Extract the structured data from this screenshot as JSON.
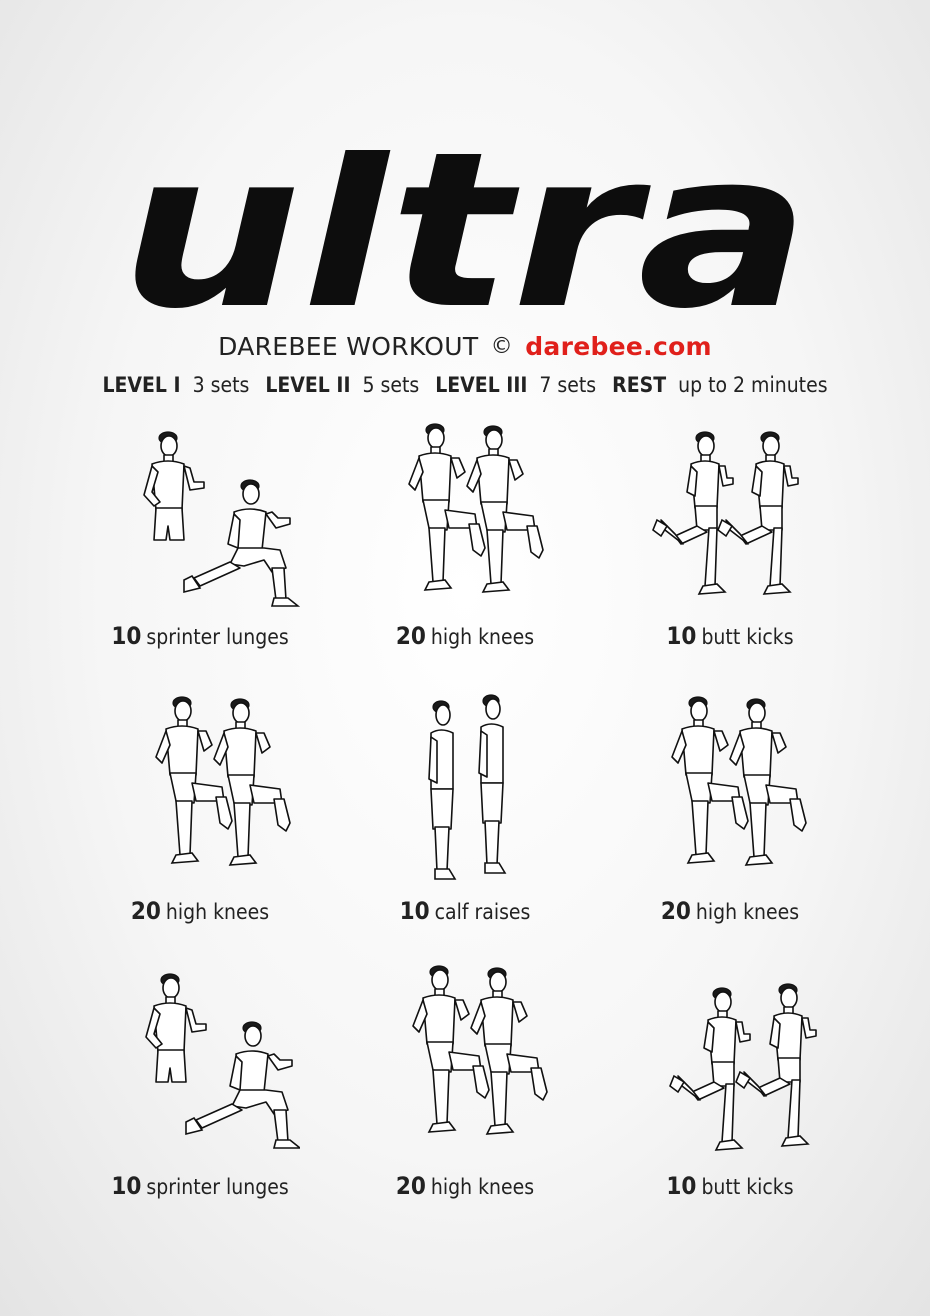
{
  "title": "ultra",
  "subtitle": {
    "prefix": "DAREBEE WORKOUT",
    "copyright": "©",
    "brand": "darebee.com"
  },
  "levels": [
    {
      "label": "LEVEL I",
      "value": "3 sets"
    },
    {
      "label": "LEVEL II",
      "value": "5 sets"
    },
    {
      "label": "LEVEL III",
      "value": "7 sets"
    },
    {
      "label": "REST",
      "value": "up to 2 minutes"
    }
  ],
  "exercises": [
    {
      "reps": "10",
      "name": "sprinter lunges",
      "icon": "sprinter-lunge-figure"
    },
    {
      "reps": "20",
      "name": "high knees",
      "icon": "high-knees-figure"
    },
    {
      "reps": "10",
      "name": "butt kicks",
      "icon": "butt-kicks-figure"
    },
    {
      "reps": "20",
      "name": "high knees",
      "icon": "high-knees-figure"
    },
    {
      "reps": "10",
      "name": "calf raises",
      "icon": "calf-raise-figure"
    },
    {
      "reps": "20",
      "name": "high knees",
      "icon": "high-knees-figure"
    },
    {
      "reps": "10",
      "name": "sprinter lunges",
      "icon": "sprinter-lunge-figure"
    },
    {
      "reps": "20",
      "name": "high knees",
      "icon": "high-knees-figure"
    },
    {
      "reps": "10",
      "name": "butt kicks",
      "icon": "butt-kicks-figure"
    }
  ],
  "colors": {
    "brand": "#e0201b",
    "text": "#1a1a1a",
    "background": "#f6f6f6"
  }
}
